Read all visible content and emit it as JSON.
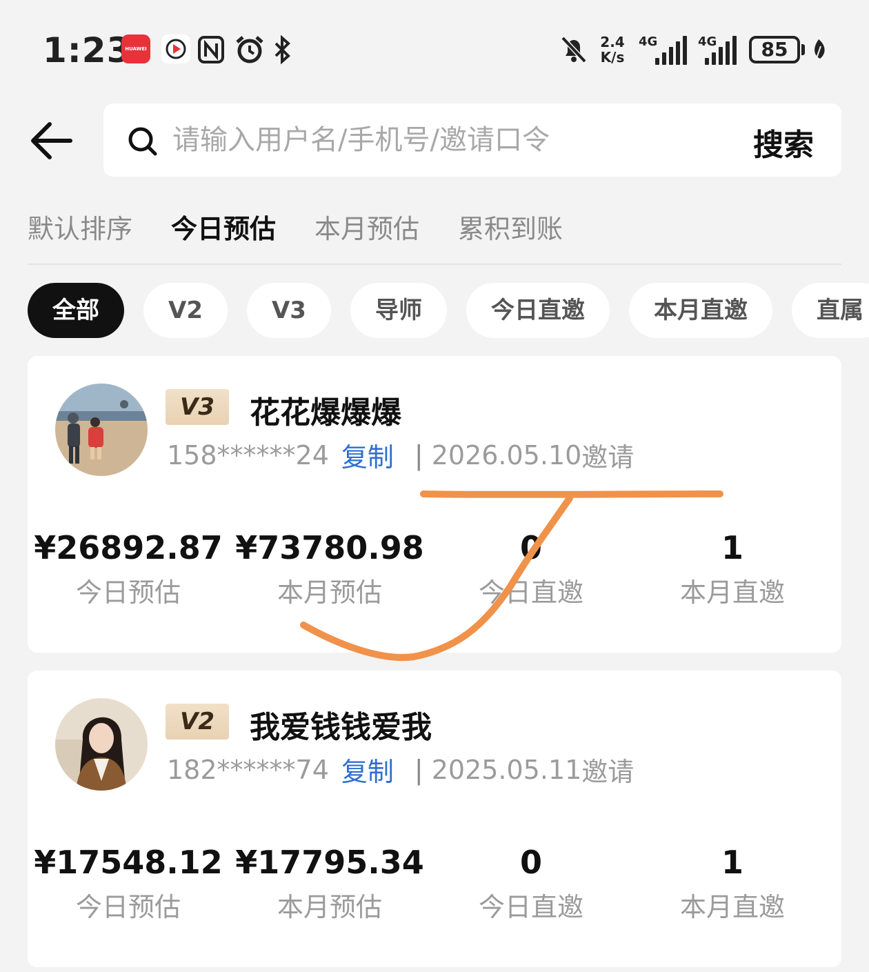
{
  "status_bar": {
    "time": "1:23",
    "huawei_label": "HUAWEI",
    "net_speed_value": "2.4",
    "net_speed_unit": "K/s",
    "signal_1_label": "4G",
    "signal_2_label": "4G",
    "battery": "85"
  },
  "search": {
    "placeholder": "请输入用户名/手机号/邀请口令",
    "button_label": "搜索"
  },
  "sort_tabs": [
    {
      "label": "默认排序",
      "active": false
    },
    {
      "label": "今日预估",
      "active": true
    },
    {
      "label": "本月预估",
      "active": false
    },
    {
      "label": "累积到账",
      "active": false
    }
  ],
  "filter_chips": [
    {
      "label": "全部",
      "active": true
    },
    {
      "label": "V2",
      "active": false
    },
    {
      "label": "V3",
      "active": false
    },
    {
      "label": "导师",
      "active": false
    },
    {
      "label": "今日直邀",
      "active": false
    },
    {
      "label": "本月直邀",
      "active": false
    },
    {
      "label": "直属",
      "active": false
    }
  ],
  "users": [
    {
      "level": "V3",
      "name": "花花爆爆爆",
      "phone": "158******24",
      "copy_label": "复制",
      "separator": "|",
      "invite_date": "2026.05.10",
      "invite_suffix": "邀请",
      "stats": [
        {
          "value": "¥26892.87",
          "label": "今日预估"
        },
        {
          "value": "¥73780.98",
          "label": "本月预估"
        },
        {
          "value": "0",
          "label": "今日直邀"
        },
        {
          "value": "1",
          "label": "本月直邀"
        }
      ]
    },
    {
      "level": "V2",
      "name": "我爱钱钱爱我",
      "phone": "182******74",
      "copy_label": "复制",
      "separator": "|",
      "invite_date": "2025.05.11",
      "invite_suffix": "邀请",
      "stats": [
        {
          "value": "¥17548.12",
          "label": "今日预估"
        },
        {
          "value": "¥17795.34",
          "label": "本月预估"
        },
        {
          "value": "0",
          "label": "今日直邀"
        },
        {
          "value": "1",
          "label": "本月直邀"
        }
      ]
    }
  ],
  "colors": {
    "background": "#f3f3f3",
    "accent_link": "#2f6fd0",
    "badge_bg": "#ecd9bd",
    "annotation_stroke": "#f0924a",
    "chip_active_bg": "#111111"
  },
  "icons": [
    "huawei-app-icon",
    "video-app-icon",
    "nfc-icon",
    "alarm-icon",
    "bluetooth-icon",
    "mute-icon",
    "signal-icon",
    "battery-icon",
    "leaf-icon",
    "back-arrow-icon",
    "search-icon"
  ]
}
